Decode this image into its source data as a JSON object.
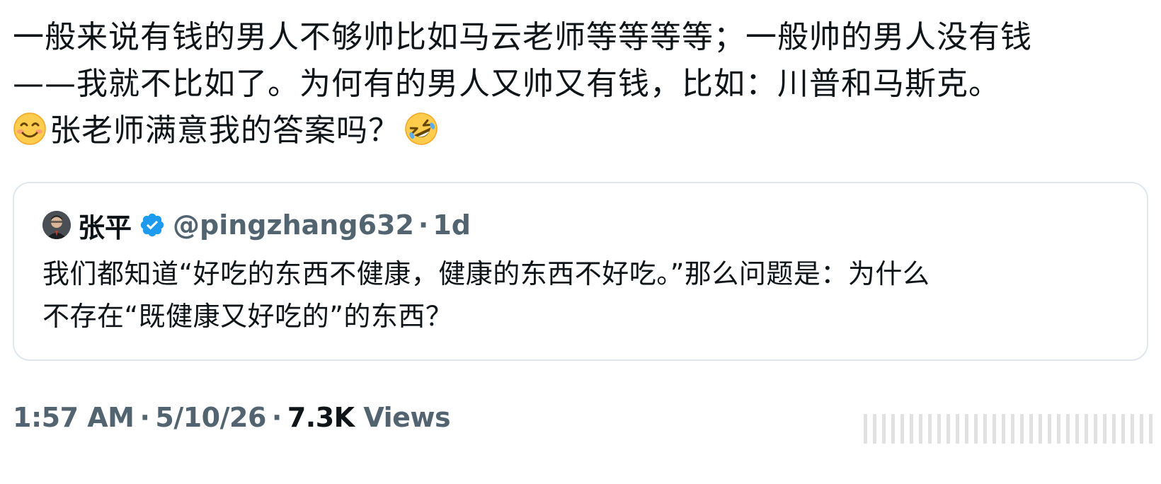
{
  "tweet": {
    "lines": [
      "一般来说有钱的男人不够帅比如马云老师等等等等；一般帅的男人没有钱",
      "——我就不比如了。为何有的男人又帅又有钱，比如：川普和马斯克。",
      "张老师满意我的答案吗？"
    ],
    "emoji_start": "smiling-face-emoji",
    "emoji_end": "rolling-on-floor-laughing-emoji"
  },
  "quote": {
    "name": "张平",
    "handle": "@pingzhang632",
    "separator": "·",
    "time": "1d",
    "verified_icon": "verified-badge-icon",
    "text_lines": [
      "我们都知道“好吃的东西不健康，健康的东西不好吃。”那么问题是：为什么",
      "不存在“既健康又好吃的”的东西？"
    ]
  },
  "meta": {
    "time": "1:57 AM",
    "sep1": "·",
    "date": "5/10/26",
    "sep2": "·",
    "views_count": "7.3K",
    "views_label": "Views"
  },
  "colors": {
    "text_primary": "#0f1419",
    "text_secondary": "#536471",
    "verified_blue": "#1d9bf0",
    "card_border": "#e1e8ed"
  }
}
